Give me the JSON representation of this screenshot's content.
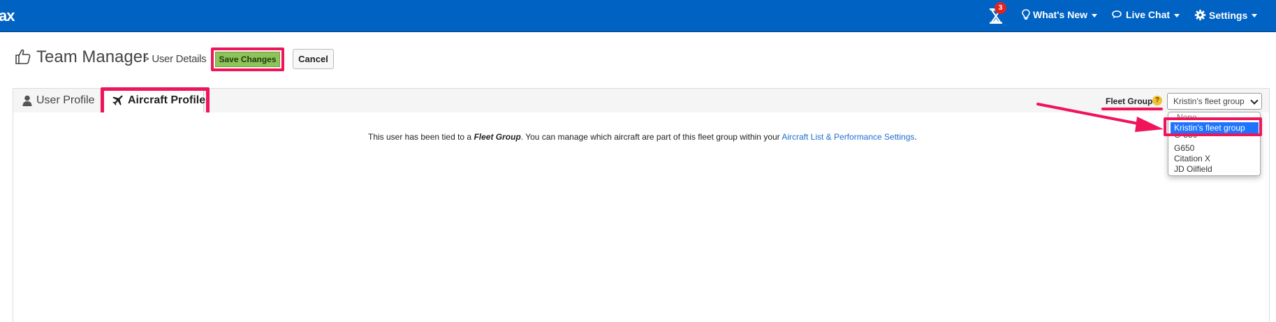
{
  "nav": {
    "brand": "ax",
    "timer_badge": "3",
    "whats_new": "What's New",
    "live_chat": "Live Chat",
    "settings": "Settings"
  },
  "header": {
    "title": "Team Manager",
    "breadcrumb": "> User Details",
    "save_label": "Save Changes",
    "cancel_label": "Cancel"
  },
  "tabs": [
    {
      "label": "User Profile",
      "icon": "user-icon",
      "active": false
    },
    {
      "label": "Aircraft Profile",
      "icon": "plane-icon",
      "active": true
    }
  ],
  "fleet": {
    "label": "Fleet Group",
    "help": "?",
    "selected": "Kristin's fleet group",
    "options": [
      "-None-",
      "Kristin's fleet group",
      "G-550",
      "G650",
      "Citation X",
      "JD Oilfield"
    ]
  },
  "content": {
    "info_prefix": "This user has been tied to a ",
    "info_em": "Fleet Group",
    "info_mid": ". You can manage which aircraft are part of this fleet group within your ",
    "info_link": "Aircraft List & Performance Settings",
    "info_suffix": "."
  },
  "colors": {
    "nav_bg": "#0063c4",
    "highlight": "#f0145a",
    "save_bg": "#8ec35a",
    "link": "#1f6fd1",
    "selected_option": "#1e74ff"
  }
}
